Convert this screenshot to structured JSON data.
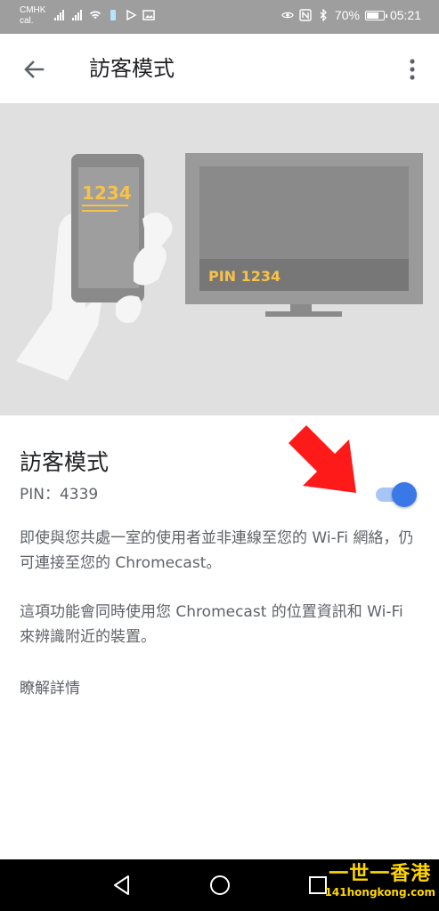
{
  "status_bar": {
    "carrier_line1": "CMHK",
    "carrier_line2": "cal.",
    "battery": "70%",
    "time": "05:21"
  },
  "app_bar": {
    "title": "訪客模式",
    "back_icon": "arrow-back-icon",
    "more_icon": "more-vert-icon"
  },
  "illustration": {
    "phone_code": "1234",
    "tv_pin_text": "PIN 1234"
  },
  "guest_mode": {
    "title": "訪客模式",
    "pin": "PIN：4339",
    "toggle_on": true,
    "accent": "#3b78e7"
  },
  "description": {
    "paragraph1": "即使與您共處一室的使用者並非連線至您的 Wi-Fi 網絡，仍可連接至您的 Chromecast。",
    "paragraph2": "這項功能會同時使用您 Chromecast 的位置資訊和 Wi-Fi 來辨識附近的裝置。",
    "learn_more": "瞭解詳情"
  },
  "nav_bar": {
    "back_icon": "triangle-back-icon",
    "home_icon": "circle-home-icon",
    "recents_icon": "square-recents-icon"
  },
  "watermark": {
    "line1": "一世一香港",
    "line2": "141hongkong.com"
  }
}
